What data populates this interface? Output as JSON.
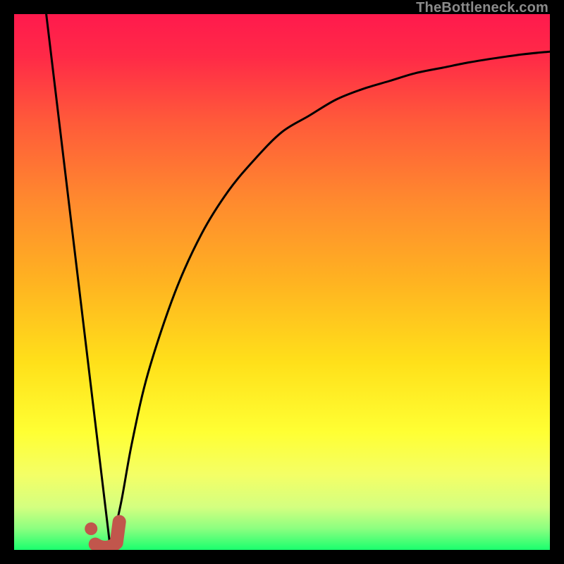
{
  "watermark": "TheBottleneck.com",
  "chart_data": {
    "type": "line",
    "title": "",
    "xlabel": "",
    "ylabel": "",
    "xlim": [
      0,
      100
    ],
    "ylim": [
      0,
      100
    ],
    "grid": false,
    "legend": false,
    "series": [
      {
        "name": "bottleneck-curve",
        "color": "#000000",
        "x": [
          6,
          8,
          10,
          12,
          14,
          16,
          17,
          18,
          20,
          22,
          25,
          30,
          35,
          40,
          45,
          50,
          55,
          60,
          65,
          70,
          75,
          80,
          85,
          90,
          95,
          100
        ],
        "y": [
          100,
          87,
          73,
          60,
          47,
          33,
          13,
          0,
          9,
          20,
          33,
          48,
          59,
          67,
          73,
          78,
          81,
          84,
          86,
          87.5,
          89,
          90,
          91,
          91.8,
          92.5,
          93
        ]
      }
    ],
    "optimal_marker": {
      "x": 17,
      "y": 0,
      "color": "#c1564c"
    },
    "background_gradient": {
      "stops": [
        {
          "pos": 0.0,
          "color": "#ff1a4d"
        },
        {
          "pos": 0.08,
          "color": "#ff2a47"
        },
        {
          "pos": 0.2,
          "color": "#ff5a3a"
        },
        {
          "pos": 0.35,
          "color": "#ff8a2e"
        },
        {
          "pos": 0.5,
          "color": "#ffb321"
        },
        {
          "pos": 0.65,
          "color": "#ffe01a"
        },
        {
          "pos": 0.78,
          "color": "#ffff33"
        },
        {
          "pos": 0.86,
          "color": "#f4ff66"
        },
        {
          "pos": 0.92,
          "color": "#d4ff80"
        },
        {
          "pos": 0.96,
          "color": "#8cff80"
        },
        {
          "pos": 1.0,
          "color": "#1aff6e"
        }
      ]
    }
  }
}
